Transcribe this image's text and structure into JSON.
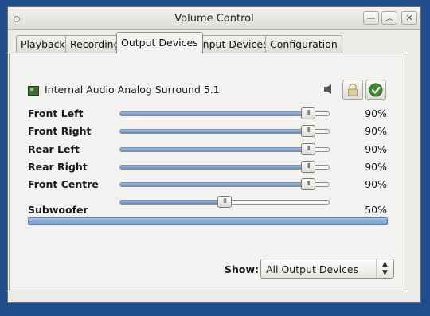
{
  "window": {
    "title": "Volume Control",
    "controls": [
      "—",
      "︿",
      "✕"
    ]
  },
  "tabs": [
    {
      "label": "Playback",
      "active": false
    },
    {
      "label": "Recording",
      "active": false
    },
    {
      "label": "Output Devices",
      "active": true
    },
    {
      "label": "Input Devices",
      "active": false
    },
    {
      "label": "Configuration",
      "active": false
    }
  ],
  "device": {
    "name": "Internal Audio Analog Surround 5.1",
    "icon": "audio-card-icon"
  },
  "channels": [
    {
      "label": "Front Left",
      "value": "90%",
      "level": 0.9
    },
    {
      "label": "Front Right",
      "value": "90%",
      "level": 0.9
    },
    {
      "label": "Rear Left",
      "value": "90%",
      "level": 0.9
    },
    {
      "label": "Rear Right",
      "value": "90%",
      "level": 0.9
    },
    {
      "label": "Front Centre",
      "value": "90%",
      "level": 0.9
    },
    {
      "label": "Subwoofer",
      "value": "50%",
      "level": 0.5
    }
  ],
  "show": {
    "label": "Show:",
    "selected": "All Output Devices"
  },
  "colors": {
    "desktop": "#1f4d8c",
    "accent": "#5d8bc7"
  }
}
